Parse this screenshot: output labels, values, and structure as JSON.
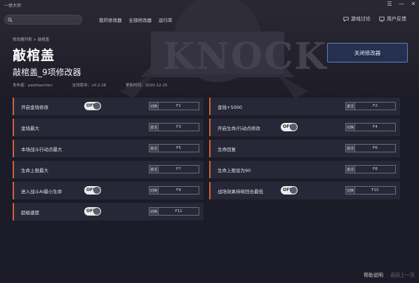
{
  "app": {
    "title": "一修大师"
  },
  "window_controls": [
    {
      "name": "menu-icon",
      "glyph": "☰"
    },
    {
      "name": "minimize-icon",
      "glyph": "—"
    },
    {
      "name": "close-icon",
      "glyph": "✕"
    }
  ],
  "search": {
    "placeholder": "",
    "value": ""
  },
  "nav": {
    "links": [
      "我的修改器",
      "全部修改器",
      "运行库"
    ],
    "right": [
      {
        "label": "游戏讨论",
        "icon": "chat-bubble-icon"
      },
      {
        "label": "用户反馈",
        "icon": "feedback-icon"
      }
    ]
  },
  "breadcrumb": "修改器列表 > 敲棺盖",
  "game": {
    "title": "敲棺盖",
    "subtitle": "敲棺盖_9项修改器",
    "publisher_label": "发布者：",
    "publisher": "peizhaochen",
    "version_label": "支持版本：",
    "version": "v0.2.28",
    "updated_label": "更新时间：",
    "updated": "2020-12-25"
  },
  "close_button": "关闭修改器",
  "cheats": [
    {
      "name": "开启金钱修改",
      "toggle": "OFF",
      "action": "切换",
      "key": "F1"
    },
    {
      "name": "金钱+5000",
      "toggle": null,
      "action": "激活",
      "key": "F2"
    },
    {
      "name": "金钱最大",
      "toggle": null,
      "action": "激活",
      "key": "F3"
    },
    {
      "name": "开启生命/行动点修改",
      "toggle": "OFF",
      "action": "切换",
      "key": "F4"
    },
    {
      "name": "本场战斗行动点最大",
      "toggle": null,
      "action": "激活",
      "key": "F5"
    },
    {
      "name": "生命回复",
      "toggle": null,
      "action": "激活",
      "key": "F6"
    },
    {
      "name": "生命上限最大",
      "toggle": null,
      "action": "激活",
      "key": "F7"
    },
    {
      "name": "生命上限设为90",
      "toggle": null,
      "action": "激活",
      "key": "F8"
    },
    {
      "name": "进入战斗AI最小生命",
      "toggle": "OFF",
      "action": "切换",
      "key": "F9"
    },
    {
      "name": "战场效果持续回合最低",
      "toggle": "OFF",
      "action": "切换",
      "key": "F10"
    },
    {
      "name": "超级速度",
      "toggle": "OFF",
      "action": "切换",
      "key": "F11"
    }
  ],
  "footer": {
    "help": "帮助说明",
    "back": "返回上一页"
  },
  "colors": {
    "accent": "#d2603b",
    "panel": "#272837",
    "background": "#1b1c27",
    "button_border": "#5a7fbd"
  }
}
